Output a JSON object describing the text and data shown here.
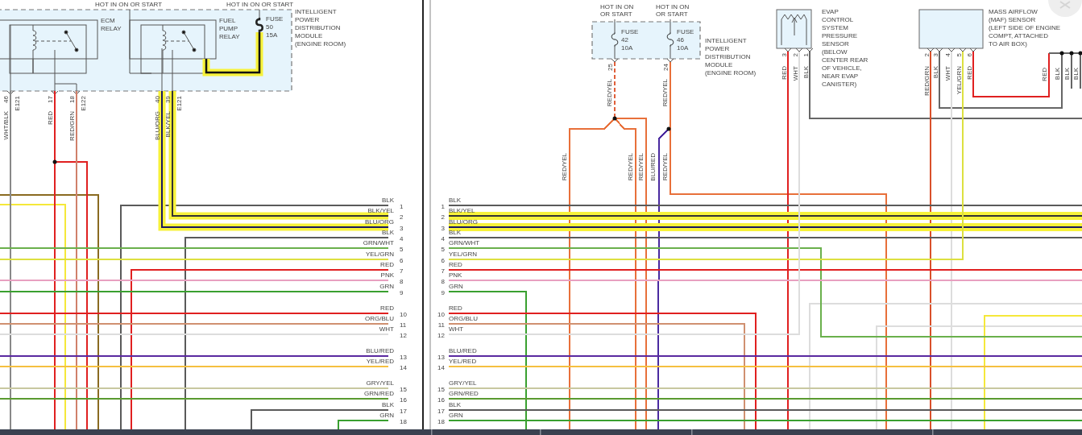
{
  "left_page": {
    "supply_labels": [
      "HOT IN ON OR START",
      "HOT IN ON OR START"
    ],
    "relays": [
      {
        "label": [
          "ECM",
          "RELAY"
        ]
      },
      {
        "label": [
          "FUEL",
          "PUMP",
          "RELAY"
        ]
      }
    ],
    "fuse": {
      "label": [
        "FUSE",
        "50",
        "15A"
      ],
      "highlighted": true
    },
    "module_label": [
      "INTELLIGENT",
      "POWER",
      "DISTRIBUTION",
      "MODULE",
      "(ENGINE ROOM)"
    ],
    "pins": [
      {
        "pin": "46",
        "connector": "E121",
        "wire": "WHT/BLK"
      },
      {
        "pin": "17",
        "wire": "RED"
      },
      {
        "pin": "18",
        "connector": "E122",
        "wire": "RED/GRN"
      },
      {
        "pin": "40",
        "wire": "BLU/ORG"
      },
      {
        "pin": "39",
        "connector": "E121",
        "wire": "BLK/YEL"
      }
    ],
    "connector_rows": [
      {
        "number": "1",
        "wire": "BLK",
        "color": "#5a5a5a",
        "highlighted": false
      },
      {
        "number": "2",
        "wire": "BLK/YEL",
        "color": "#333333",
        "highlighted": true
      },
      {
        "number": "3",
        "wire": "BLU/ORG",
        "color": "#1a1a60",
        "highlighted": true
      },
      {
        "number": "4",
        "wire": "BLK",
        "color": "#5a5a5a",
        "highlighted": false
      },
      {
        "number": "5",
        "wire": "GRN/WHT",
        "color": "#6ab04c",
        "highlighted": false
      },
      {
        "number": "6",
        "wire": "YEL/GRN",
        "color": "#dde040",
        "highlighted": false
      },
      {
        "number": "7",
        "wire": "RED",
        "color": "#e02020",
        "highlighted": false
      },
      {
        "number": "8",
        "wire": "PNK",
        "color": "#e8a0c0",
        "highlighted": false
      },
      {
        "number": "9",
        "wire": "GRN",
        "color": "#3aa030",
        "highlighted": false
      },
      {
        "number": "10",
        "wire": "RED",
        "color": "#e02020",
        "highlighted": false
      },
      {
        "number": "11",
        "wire": "ORG/BLU",
        "color": "#d09070",
        "highlighted": false
      },
      {
        "number": "12",
        "wire": "WHT",
        "color": "#dddddd",
        "highlighted": false
      },
      {
        "number": "13",
        "wire": "BLU/RED",
        "color": "#5a2aa0",
        "highlighted": false
      },
      {
        "number": "14",
        "wire": "YEL/RED",
        "color": "#f5c040",
        "highlighted": false
      },
      {
        "number": "15",
        "wire": "GRY/YEL",
        "color": "#c8c8a0",
        "highlighted": false
      },
      {
        "number": "16",
        "wire": "GRN/RED",
        "color": "#5a9a30",
        "highlighted": false
      },
      {
        "number": "17",
        "wire": "BLK",
        "color": "#5a5a5a",
        "highlighted": false
      },
      {
        "number": "18",
        "wire": "GRN",
        "color": "#3aa030",
        "highlighted": false
      }
    ]
  },
  "right_page": {
    "supply_labels": [
      [
        "HOT IN ON",
        "OR START"
      ],
      [
        "HOT IN ON",
        "OR START"
      ]
    ],
    "fuses": [
      {
        "label": [
          "FUSE",
          "42",
          "10A"
        ],
        "pin": "25",
        "wire": "RED/YEL"
      },
      {
        "label": [
          "FUSE",
          "46",
          "10A"
        ],
        "pin": "24",
        "wire": "RED/YEL"
      }
    ],
    "module_label": [
      "INTELLIGENT",
      "POWER",
      "DISTRIBUTION",
      "MODULE",
      "(ENGINE ROOM)"
    ],
    "branch_wires": [
      "RED/YEL",
      "RED/YEL",
      "RED/YEL",
      "BLU/RED",
      "RED/YEL"
    ],
    "sensors": [
      {
        "label": [
          "EVAP",
          "CONTROL",
          "SYSTEM",
          "PRESSURE",
          "SENSOR",
          "(BELOW",
          "CENTER REAR",
          "OF VEHICLE,",
          "NEAR EVAP",
          "CANISTER)"
        ],
        "pins": [
          {
            "pin": "3",
            "wire": "RED"
          },
          {
            "pin": "2",
            "wire": "WHT"
          },
          {
            "pin": "1",
            "wire": "BLK"
          }
        ]
      },
      {
        "label": [
          "MASS AIRFLOW",
          "(MAF) SENSOR",
          "(LEFT SIDE OF ENGINE",
          "COMPT, ATTACHED",
          "TO AIR BOX)"
        ],
        "pins": [
          {
            "pin": "2",
            "wire": "RED/GRN"
          },
          {
            "pin": "3",
            "wire": "BLK"
          },
          {
            "pin": "4",
            "wire": "WHT"
          },
          {
            "pin": "5",
            "wire": "YEL/GRN"
          },
          {
            "pin": "6",
            "wire": "RED"
          }
        ]
      }
    ],
    "ground_wires": [
      "RED",
      "BLK",
      "BLK",
      "BLK"
    ],
    "connector_rows": [
      {
        "number": "1",
        "wire": "BLK",
        "color": "#5a5a5a",
        "highlighted": false
      },
      {
        "number": "2",
        "wire": "BLK/YEL",
        "color": "#333333",
        "highlighted": true
      },
      {
        "number": "3",
        "wire": "BLU/ORG",
        "color": "#1a1a60",
        "highlighted": true
      },
      {
        "number": "4",
        "wire": "BLK",
        "color": "#5a5a5a",
        "highlighted": false
      },
      {
        "number": "5",
        "wire": "GRN/WHT",
        "color": "#6ab04c",
        "highlighted": false
      },
      {
        "number": "6",
        "wire": "YEL/GRN",
        "color": "#dde040",
        "highlighted": false
      },
      {
        "number": "7",
        "wire": "RED",
        "color": "#e02020",
        "highlighted": false
      },
      {
        "number": "8",
        "wire": "PNK",
        "color": "#e8a0c0",
        "highlighted": false
      },
      {
        "number": "9",
        "wire": "GRN",
        "color": "#3aa030",
        "highlighted": false
      },
      {
        "number": "10",
        "wire": "RED",
        "color": "#e02020",
        "highlighted": false
      },
      {
        "number": "11",
        "wire": "ORG/BLU",
        "color": "#d09070",
        "highlighted": false
      },
      {
        "number": "12",
        "wire": "WHT",
        "color": "#dddddd",
        "highlighted": false
      },
      {
        "number": "13",
        "wire": "BLU/RED",
        "color": "#5a2aa0",
        "highlighted": false
      },
      {
        "number": "14",
        "wire": "YEL/RED",
        "color": "#f5c040",
        "highlighted": false
      },
      {
        "number": "15",
        "wire": "GRY/YEL",
        "color": "#c8c8a0",
        "highlighted": false
      },
      {
        "number": "16",
        "wire": "GRN/RED",
        "color": "#5a9a30",
        "highlighted": false
      },
      {
        "number": "17",
        "wire": "BLK",
        "color": "#5a5a5a",
        "highlighted": false
      },
      {
        "number": "18",
        "wire": "GRN",
        "color": "#3aa030",
        "highlighted": false
      }
    ]
  }
}
